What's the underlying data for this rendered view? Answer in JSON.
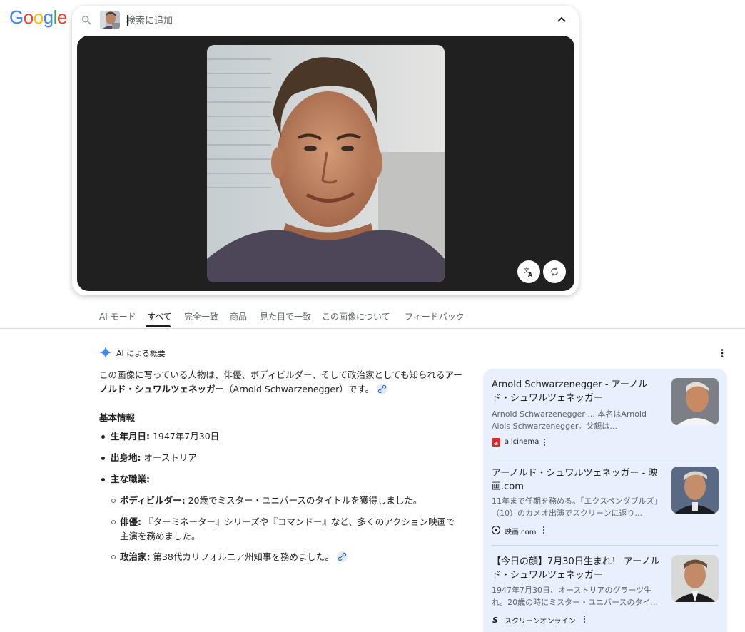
{
  "logo": {
    "text": "Google"
  },
  "search": {
    "placeholder": "検索に追加"
  },
  "tabs": [
    {
      "label": "AI モード"
    },
    {
      "label": "すべて"
    },
    {
      "label": "完全一致"
    },
    {
      "label": "商品"
    },
    {
      "label": "見た目で一致"
    },
    {
      "label": "この画像について"
    },
    {
      "label": "フィードバック"
    }
  ],
  "ai_overview": {
    "title": "AI による概要",
    "intro_part1": "この画像に写っている人物は、俳優、ボディビルダー、そして政治家としても知られる",
    "intro_name": "アーノルド・シュワルツェネッガー",
    "intro_part2": "（Arnold Schwarzenegger）です。",
    "section_title": "基本情報",
    "facts": [
      {
        "label": "生年月日:",
        "value": " 1947年7月30日"
      },
      {
        "label": "出身地:",
        "value": " オーストリア"
      },
      {
        "label": "主な職業:",
        "value": ""
      }
    ],
    "occupations": [
      {
        "label": "ボディビルダー:",
        "value": " 20歳でミスター・ユニバースのタイトルを獲得しました。"
      },
      {
        "label": "俳優:",
        "value": " 『ターミネーター』シリーズや『コマンドー』など、多くのアクション映画で主演を務めました。"
      },
      {
        "label": "政治家:",
        "value": " 第38代カリフォルニア州知事を務めました。"
      }
    ]
  },
  "sources": [
    {
      "title": "Arnold Schwarzenegger - アーノルド・シュワルツェネッガー",
      "snippet": "Arnold Schwarzenegger ... 本名はArnold Alois Schwarzenegger。父親は...",
      "site": "allcinema"
    },
    {
      "title": "アーノルド・シュワルツェネッガー - 映画.com",
      "snippet": "11年まで任期を務める。「エクスペンダブルズ」（10）のカメオ出演でスクリーンに返り...",
      "site": "映画.com"
    },
    {
      "title": "【今日の顔】7月30日生まれ！ アーノルド・シュワルツェネッガー",
      "snippet": "1947年7月30日、オーストリアのグラーツ生れ。20歳の時にミスター・ユニバースのタイ...",
      "site": "スクリーンオンライン"
    }
  ],
  "icons": {
    "search": "search-icon",
    "collapse": "chevron-up-icon",
    "translate": "translate-icon",
    "rotate": "rotate-icon",
    "sparkle": "sparkle-icon",
    "menu": "more-vert-icon",
    "link": "link-icon"
  },
  "colors": {
    "link_chip": "#e8eaed",
    "source_panel": "#e8f0fe",
    "lens_panel": "#202020",
    "ai_sparkle": "#4285f4"
  }
}
